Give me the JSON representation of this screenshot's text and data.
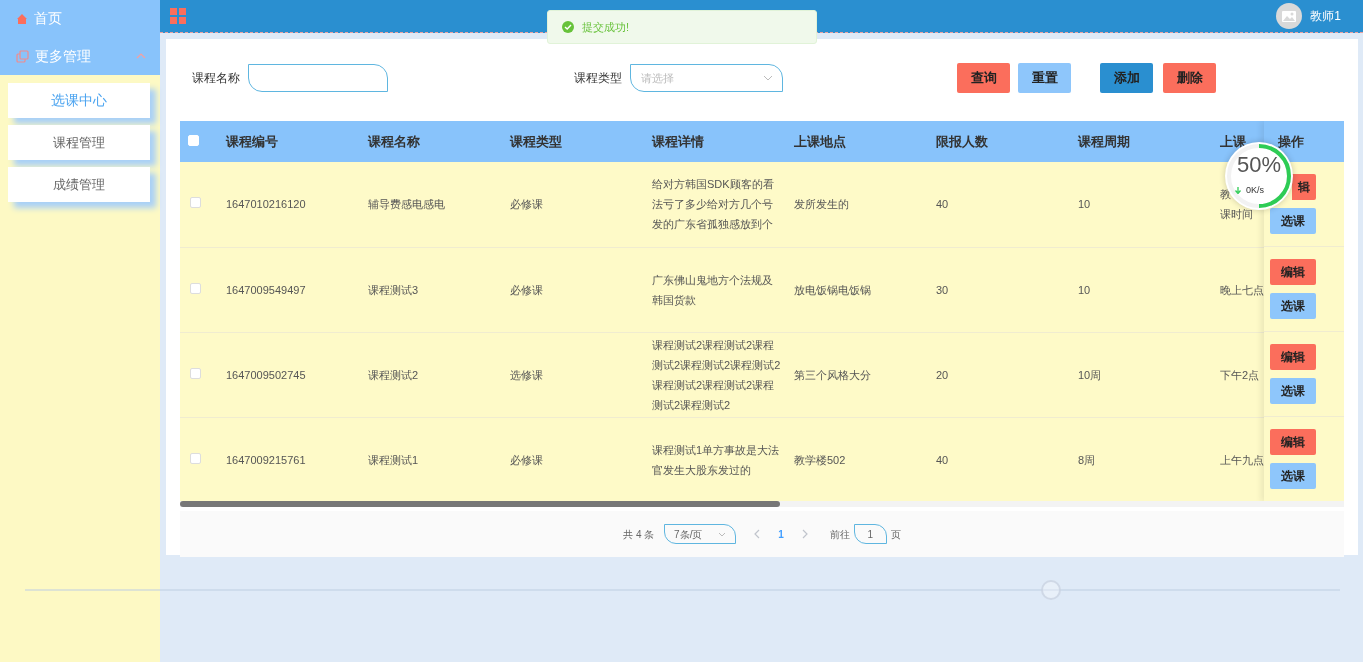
{
  "sidebar": {
    "items": [
      {
        "label": "首页"
      },
      {
        "label": "更多管理",
        "expanded": true,
        "children": [
          {
            "label": "选课中心",
            "selected": true
          },
          {
            "label": "课程管理",
            "selected": false
          },
          {
            "label": "成绩管理",
            "selected": false
          }
        ]
      }
    ]
  },
  "header": {
    "user": "教师1"
  },
  "toast": {
    "message": "提交成功!"
  },
  "search": {
    "fields": [
      {
        "label": "课程名称",
        "kind": "text"
      },
      {
        "label": "课程类型",
        "kind": "select",
        "placeholder": "请选择"
      }
    ],
    "buttons": [
      {
        "label": "查询",
        "kind": "danger"
      },
      {
        "label": "重置",
        "kind": "light"
      },
      {
        "label": "添加",
        "kind": "primary"
      },
      {
        "label": "删除",
        "kind": "danger"
      }
    ]
  },
  "table": {
    "header_checked": false,
    "columns": [
      "课程编号",
      "课程名称",
      "课程类型",
      "课程详情",
      "上课地点",
      "限报人数",
      "课程周期",
      "上课",
      "操作"
    ],
    "rows": [
      {
        "checked": false,
        "cells": [
          "1647010216120",
          "辅导费感电感电",
          "必修课",
          "给对方韩国SDK顾客的看法亏了多少给对方几个号发的广东省孤独感放到个",
          "发所发生的",
          "40",
          "10"
        ],
        "time_lines": [
          "教",
          "课时间"
        ],
        "actions": [
          "辑",
          "选课"
        ]
      },
      {
        "checked": false,
        "cells": [
          "1647009549497",
          "课程测试3",
          "必修课",
          "广东佛山鬼地方个法规及韩国货款",
          "放电饭锅电饭锅",
          "30",
          "10"
        ],
        "time_lines": [
          "晚上七点"
        ],
        "actions": [
          "编辑",
          "选课"
        ]
      },
      {
        "checked": false,
        "cells": [
          "1647009502745",
          "课程测试2",
          "选修课",
          "课程测试2课程测试2课程测试2课程测试2课程测试2课程测试2课程测试2课程测试2课程测试2",
          "第三个风格大分",
          "20",
          "10周"
        ],
        "time_lines": [
          "下午2点"
        ],
        "actions": [
          "编辑",
          "选课"
        ]
      },
      {
        "checked": false,
        "cells": [
          "1647009215761",
          "课程测试1",
          "必修课",
          "课程测试1单方事故是大法官发生大股东发过的",
          "教学楼502",
          "40",
          "8周"
        ],
        "time_lines": [
          "上午九点"
        ],
        "actions": [
          "编辑",
          "选课"
        ]
      }
    ]
  },
  "pagination": {
    "total": "共 4 条",
    "page_size": "7条/页",
    "pages": [
      {
        "label": "1",
        "selected": true
      }
    ],
    "goto_label": "前往",
    "goto_value": "1",
    "goto_suffix": "页"
  },
  "speed_widget": {
    "percent": "50%",
    "speed": "0K/s",
    "level": 0.5
  },
  "background_slider": {
    "level": 0.78
  }
}
